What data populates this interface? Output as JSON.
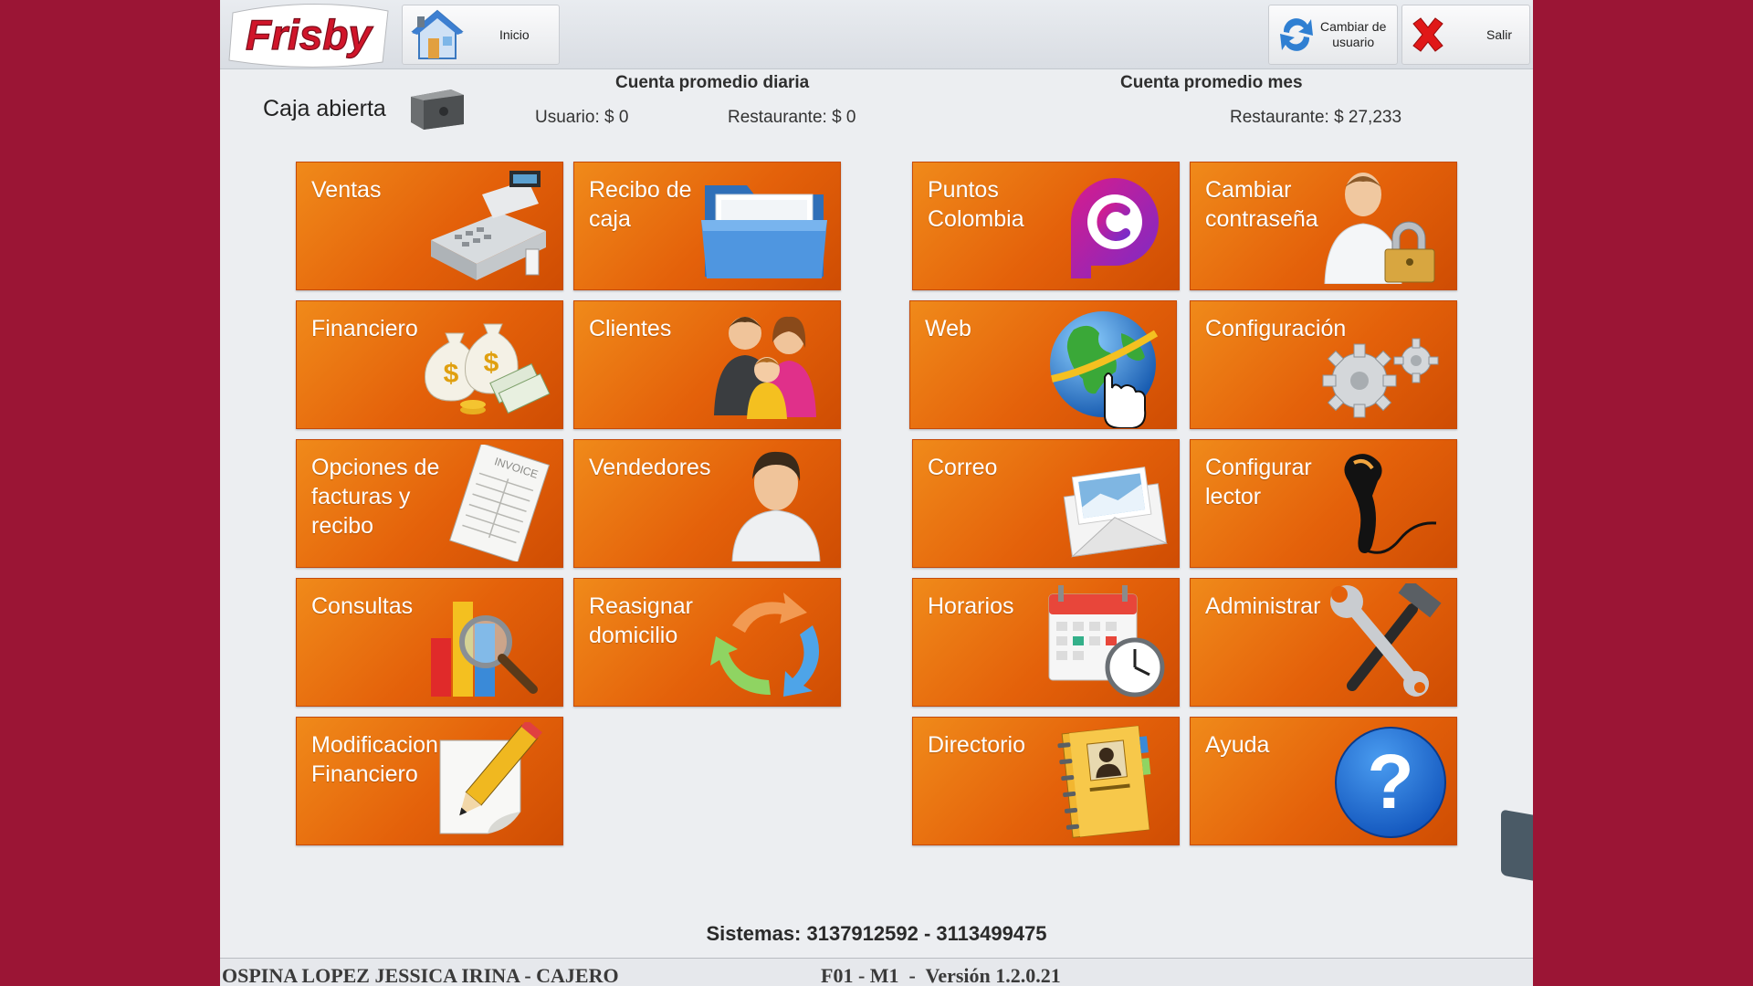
{
  "app": {
    "brand": "Frisby",
    "home_label": "Inicio",
    "switch_user_label": "Cambiar de\nusuario",
    "exit_label": "Salir"
  },
  "register": {
    "status_label": "Caja abierta"
  },
  "stats": {
    "daily_title": "Cuenta promedio diaria",
    "daily_user": "Usuario: $ 0",
    "daily_restaurant": "Restaurante: $ 0",
    "monthly_title": "Cuenta promedio mes",
    "monthly_restaurant": "Restaurante: $ 27,233"
  },
  "tiles": [
    {
      "label": "Ventas",
      "icon": "cash-register-icon"
    },
    {
      "label": "Recibo de\ncaja",
      "icon": "folder-icon"
    },
    {
      "label": "Puntos\nColombia",
      "icon": "puntos-colombia-logo-icon"
    },
    {
      "label": "Cambiar\ncontraseña",
      "icon": "user-lock-icon"
    },
    {
      "label": "Financiero",
      "icon": "money-bags-icon"
    },
    {
      "label": "Clientes",
      "icon": "family-icon"
    },
    {
      "label": "Web",
      "icon": "globe-icon"
    },
    {
      "label": "Configuración",
      "icon": "gears-icon"
    },
    {
      "label": "Opciones de\nfacturas y\nrecibo",
      "icon": "invoice-icon"
    },
    {
      "label": "Vendedores",
      "icon": "person-icon"
    },
    {
      "label": "Correo",
      "icon": "envelope-icon"
    },
    {
      "label": "Configurar\nlector",
      "icon": "barcode-scanner-icon"
    },
    {
      "label": "Consultas",
      "icon": "chart-magnifier-icon"
    },
    {
      "label": "Reasignar\ndomicilio",
      "icon": "refresh-arrows-icon"
    },
    {
      "label": "Horarios",
      "icon": "calendar-clock-icon"
    },
    {
      "label": "Administrar",
      "icon": "wrench-hammer-icon"
    },
    {
      "label": "Modificacion\nFinanciero",
      "icon": "pencil-note-icon"
    },
    {
      "label": "Directorio",
      "icon": "address-book-icon"
    },
    {
      "label": "Ayuda",
      "icon": "help-question-icon"
    }
  ],
  "footer": {
    "systems": "Sistemas: 3137912592 - 3113499475",
    "user": "OSPINA LOPEZ JESSICA IRINA - CAJERO",
    "version": "F01 - M1  -  Versión 1.2.0.21"
  },
  "colors": {
    "background": "#9b1535",
    "tile": "#e4610a",
    "brand_red": "#d0152a"
  }
}
